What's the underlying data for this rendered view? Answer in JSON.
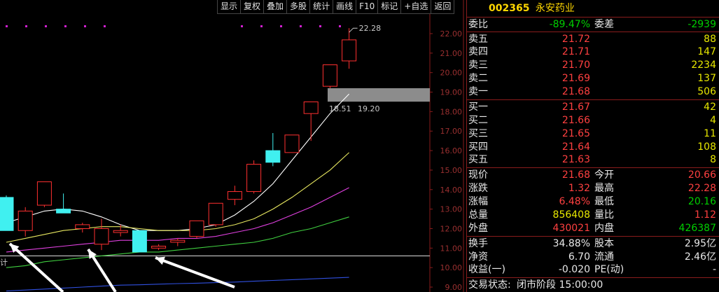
{
  "toolbar": {
    "buttons": [
      "显示",
      "复权",
      "叠加",
      "多股",
      "统计",
      "画线",
      "F10",
      "标记",
      "+自选",
      "返回"
    ]
  },
  "chart_data": {
    "type": "candlestick",
    "y_ticks": [
      "22.00",
      "21.00",
      "20.00",
      "19.00",
      "18.00",
      "17.00",
      "16.00",
      "15.00",
      "14.00",
      "13.00",
      "12.00",
      "11.00",
      "10.00",
      "9.00"
    ],
    "ylim": [
      9.0,
      22.6
    ],
    "high_label": "22.28",
    "gap_labels": [
      "18.51",
      "19.20"
    ],
    "gap_range": [
      18.51,
      19.2
    ],
    "reference_line": 10.6,
    "left_cut_label": "计",
    "candles": [
      {
        "o": 13.6,
        "h": 13.7,
        "l": 11.9,
        "c": 11.9,
        "up": false
      },
      {
        "o": 11.9,
        "h": 13.1,
        "l": 11.6,
        "c": 12.9,
        "up": true
      },
      {
        "o": 13.2,
        "h": 14.4,
        "l": 13.1,
        "c": 14.4,
        "up": true
      },
      {
        "o": 13.0,
        "h": 13.8,
        "l": 12.8,
        "c": 12.8,
        "up": false
      },
      {
        "o": 12.0,
        "h": 12.3,
        "l": 11.8,
        "c": 12.2,
        "up": true
      },
      {
        "o": 11.2,
        "h": 12.5,
        "l": 10.9,
        "c": 12.0,
        "up": true
      },
      {
        "o": 11.8,
        "h": 12.2,
        "l": 11.6,
        "c": 11.9,
        "up": true
      },
      {
        "o": 11.9,
        "h": 11.9,
        "l": 10.8,
        "c": 10.8,
        "up": false
      },
      {
        "o": 11.0,
        "h": 11.2,
        "l": 10.9,
        "c": 11.1,
        "up": true
      },
      {
        "o": 11.3,
        "h": 11.5,
        "l": 11.1,
        "c": 11.4,
        "up": true
      },
      {
        "o": 11.6,
        "h": 12.4,
        "l": 11.5,
        "c": 12.4,
        "up": true
      },
      {
        "o": 12.2,
        "h": 13.3,
        "l": 12.1,
        "c": 13.3,
        "up": true
      },
      {
        "o": 13.5,
        "h": 14.2,
        "l": 13.2,
        "c": 13.9,
        "up": true
      },
      {
        "o": 13.9,
        "h": 15.5,
        "l": 13.8,
        "c": 15.3,
        "up": true
      },
      {
        "o": 16.0,
        "h": 16.9,
        "l": 15.2,
        "c": 15.4,
        "up": false
      },
      {
        "o": 15.9,
        "h": 16.8,
        "l": 15.9,
        "c": 16.8,
        "up": true
      },
      {
        "o": 17.9,
        "h": 18.5,
        "l": 16.5,
        "c": 18.5,
        "up": true
      },
      {
        "o": 19.3,
        "h": 20.4,
        "l": 19.2,
        "c": 20.4,
        "up": true
      },
      {
        "o": 20.6,
        "h": 22.28,
        "l": 20.2,
        "c": 21.68,
        "up": true
      }
    ],
    "ma_lines": [
      {
        "color": "#ffffff",
        "values": [
          12.3,
          12.6,
          12.9,
          13.0,
          12.9,
          12.6,
          12.2,
          11.9,
          11.9,
          11.9,
          12.0,
          12.2,
          12.7,
          13.4,
          14.3,
          15.5,
          16.7,
          17.9,
          18.9
        ]
      },
      {
        "color": "#e8e860",
        "values": [
          11.3,
          11.5,
          11.7,
          11.9,
          12.0,
          12.1,
          12.1,
          12.0,
          11.9,
          11.9,
          11.9,
          12.0,
          12.2,
          12.5,
          13.0,
          13.6,
          14.3,
          15.0,
          15.9
        ]
      },
      {
        "color": "#e040e0",
        "values": [
          10.8,
          10.9,
          11.0,
          11.1,
          11.2,
          11.3,
          11.4,
          11.4,
          11.4,
          11.5,
          11.5,
          11.6,
          11.8,
          12.0,
          12.3,
          12.7,
          13.1,
          13.6,
          14.1
        ]
      },
      {
        "color": "#40d040",
        "values": [
          10.0,
          10.1,
          10.3,
          10.4,
          10.5,
          10.6,
          10.7,
          10.8,
          10.8,
          10.9,
          11.0,
          11.1,
          11.2,
          11.3,
          11.5,
          11.8,
          12.0,
          12.3,
          12.6
        ]
      },
      {
        "color": "#3050e0",
        "values": [
          8.8,
          8.85,
          8.9,
          8.95,
          9.0,
          9.05,
          9.1,
          9.12,
          9.15,
          9.18,
          9.2,
          9.23,
          9.26,
          9.3,
          9.34,
          9.38,
          9.42,
          9.46,
          9.5
        ]
      }
    ]
  },
  "quote": {
    "code": "002365",
    "name": "永安药业",
    "weibi_label": "委比",
    "weibi_value": "-89.47%",
    "weicha_label": "委差",
    "weicha_value": "-2939",
    "sell": [
      {
        "label": "卖五",
        "price": "21.72",
        "vol": "88"
      },
      {
        "label": "卖四",
        "price": "21.71",
        "vol": "147"
      },
      {
        "label": "卖三",
        "price": "21.70",
        "vol": "2234"
      },
      {
        "label": "卖二",
        "price": "21.69",
        "vol": "137"
      },
      {
        "label": "卖一",
        "price": "21.68",
        "vol": "506"
      }
    ],
    "buy": [
      {
        "label": "买一",
        "price": "21.67",
        "vol": "42"
      },
      {
        "label": "买二",
        "price": "21.66",
        "vol": "4"
      },
      {
        "label": "买三",
        "price": "21.65",
        "vol": "11"
      },
      {
        "label": "买四",
        "price": "21.64",
        "vol": "108"
      },
      {
        "label": "买五",
        "price": "21.63",
        "vol": "8"
      }
    ],
    "stats": [
      {
        "l1": "现价",
        "v1": "21.68",
        "c1": "red",
        "l2": "今开",
        "v2": "20.66",
        "c2": "red"
      },
      {
        "l1": "涨跌",
        "v1": "1.32",
        "c1": "red",
        "l2": "最高",
        "v2": "22.28",
        "c2": "red"
      },
      {
        "l1": "涨幅",
        "v1": "6.48%",
        "c1": "red",
        "l2": "最低",
        "v2": "20.16",
        "c2": "green"
      },
      {
        "l1": "总量",
        "v1": "856408",
        "c1": "yellow",
        "l2": "量比",
        "v2": "1.12",
        "c2": "red"
      },
      {
        "l1": "外盘",
        "v1": "430021",
        "c1": "red",
        "l2": "内盘",
        "v2": "426387",
        "c2": "green"
      }
    ],
    "extra": [
      {
        "l1": "换手",
        "v1": "34.88%",
        "l2": "股本",
        "v2": "2.95亿"
      },
      {
        "l1": "净资",
        "v1": "6.70",
        "l2": "流通",
        "v2": "2.46亿"
      },
      {
        "l1": "收益(一)",
        "v1": "-0.020",
        "l2": "PE(动)",
        "v2": "-"
      }
    ],
    "status_label": "交易状态:",
    "status_value": "闭市阶段 15:00:00"
  }
}
